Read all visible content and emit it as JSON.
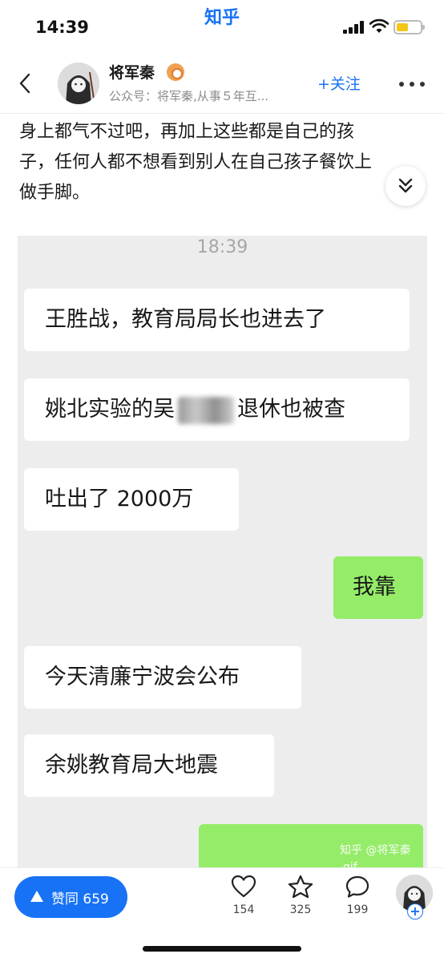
{
  "status_bar": {
    "time": "14:39",
    "app_name": "知乎",
    "battery_color": "#f5c518"
  },
  "nav": {
    "back_icon": "chevron-left-icon",
    "author_name": "将军秦",
    "badge_icon": "verified-eye-icon",
    "author_subtitle": "公众号：将军秦,从事５年互...",
    "follow_label": "+关注",
    "more_icon": "more-dots-icon"
  },
  "article": {
    "text_lines": [
      "身上都气不过吧，再加上这些都是自己的孩",
      "子，任何人都不想看到别人在自己孩子餐饮上",
      "做手脚。"
    ],
    "expand_icon": "double-chevron-down-icon"
  },
  "chat_image": {
    "timestamp": "18:39",
    "messages": [
      {
        "side": "left",
        "text": "王胜战，教育局局长也进去了"
      },
      {
        "side": "left",
        "text_before": "姚北实验的吴",
        "text_after": "退休也被查",
        "redacted": true
      },
      {
        "side": "left",
        "text": "吐出了 2000万"
      },
      {
        "side": "right",
        "text": "我靠"
      },
      {
        "side": "left",
        "text": "今天清廉宁波会公布"
      },
      {
        "side": "left",
        "text": "余姚教育局大地震"
      },
      {
        "side": "right",
        "text": ""
      }
    ],
    "watermark": "知乎 @将军秦",
    "gif_badge": "gif",
    "bubble_colors": {
      "left": "#ffffff",
      "right": "#95ec69"
    }
  },
  "bottom_bar": {
    "vote_label": "赞同 659",
    "like_count": "154",
    "favorite_count": "325",
    "comment_count": "199",
    "like_icon": "heart-icon",
    "favorite_icon": "star-icon",
    "comment_icon": "comment-bubble-icon",
    "plus_label": "+"
  },
  "accent_color": "#1772f6"
}
